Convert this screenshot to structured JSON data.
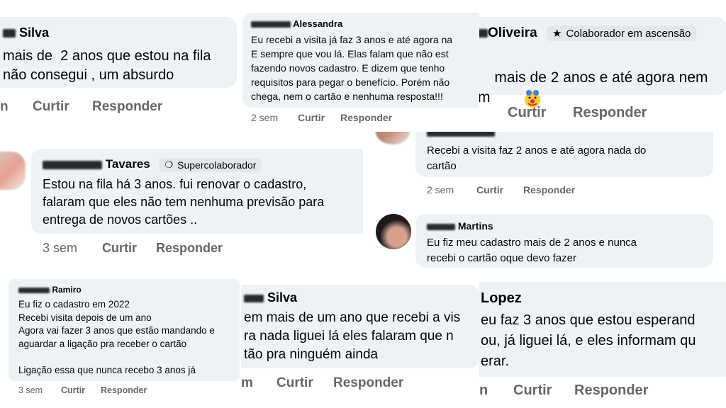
{
  "comments": [
    {
      "name": "Silva",
      "text": "mais de  2 anos que estou na fila\nnão consegui , um absurdo",
      "actions": [
        "n",
        "Curtir",
        "Responder"
      ]
    },
    {
      "name": "Alessandra",
      "text": "Eu recebi a visita já faz 3 anos e até agora na\nE sempre que vou lá. Elas falam que não est\nfazendo novos cadastro. E dizem que tenho\nrequisitos para pegar o benefício. Porém não\nchega, nem o cartão e nenhuma resposta!!!",
      "time": "2 sem",
      "actions": [
        "Curtir",
        "Responder"
      ]
    },
    {
      "name": "Oliveira",
      "badge": "Colaborador em ascensão",
      "text": "mais de 2 anos e até agora nem\nm",
      "actions": [
        "Curtir",
        "Responder"
      ]
    },
    {
      "name": "Tavares",
      "badge": "Supercolaborador",
      "text": "Estou na fila há 3 anos. fui renovar o cadastro,\nfalaram que eles não tem nenhuma previsão para\nentrega de novos cartões ..",
      "time": "3 sem",
      "actions": [
        "Curtir",
        "Responder"
      ]
    },
    {
      "name": "",
      "text": "Recebi a visita faz 2 anos e até agora nada do\ncartão",
      "time": "2 sem",
      "actions": [
        "Curtir",
        "Responder"
      ]
    },
    {
      "name": "Martins",
      "text": "Eu fiz meu cadastro mais de 2 anos e nunca\nrecebi o cartão oque devo fazer",
      "actions": []
    },
    {
      "name": "Ramiro",
      "text": "Eu fiz o cadastro em 2022\nRecebi visita depois de um ano\nAgora vai fazer 3 anos que estão mandando e\naguardar a ligação pra receber o cartão\n\nLigação essa que nunca recebo 3 anos já",
      "time": "3 sem",
      "actions": [
        "Curtir",
        "Responder"
      ]
    },
    {
      "name": "Silva",
      "text": "em mais de um ano que recebi a vis\nra nada liguei lá eles falaram que n\ntão pra ninguém ainda",
      "actions": [
        "m",
        "Curtir",
        "Responder"
      ]
    },
    {
      "name": "Lopez",
      "text": "eu faz 3 anos que estou esperand\nou, já liguei lá, e eles informam qu\nerar.",
      "actions": [
        "n",
        "Curtir",
        "Responder"
      ]
    }
  ],
  "icons": {
    "badge_star": "star-icon",
    "badge_super": "award-icon",
    "emoji": "clown-emoji"
  },
  "colors": {
    "bubble": "#eff2f5",
    "meta": "#65676b",
    "badge": "#e4e6eb"
  }
}
